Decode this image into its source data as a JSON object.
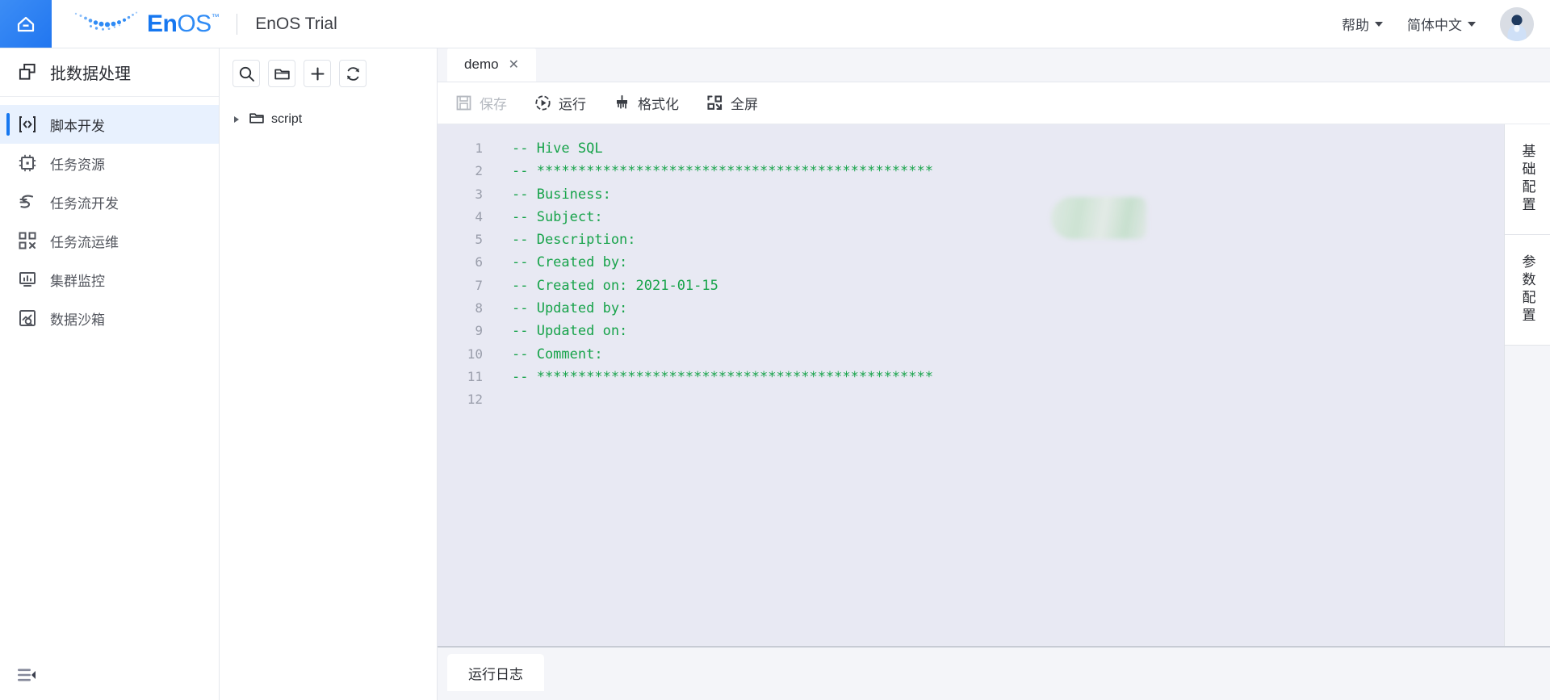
{
  "header": {
    "home_icon": "home-icon",
    "logo_en": "En",
    "logo_os": "OS",
    "logo_tm": "™",
    "product_title": "EnOS Trial",
    "help_label": "帮助",
    "language_label": "简体中文",
    "avatar": "user-avatar"
  },
  "sidebar": {
    "section_title": "批数据处理",
    "section_icon": "batch-data-icon",
    "items": [
      {
        "label": "脚本开发",
        "icon": "script-dev-icon",
        "active": true
      },
      {
        "label": "任务资源",
        "icon": "task-resource-icon",
        "active": false
      },
      {
        "label": "任务流开发",
        "icon": "workflow-dev-icon",
        "active": false
      },
      {
        "label": "任务流运维",
        "icon": "workflow-ops-icon",
        "active": false
      },
      {
        "label": "集群监控",
        "icon": "cluster-monitor-icon",
        "active": false
      },
      {
        "label": "数据沙箱",
        "icon": "data-sandbox-icon",
        "active": false
      }
    ],
    "collapse_icon": "collapse-sidebar-icon"
  },
  "tree": {
    "toolbar": [
      {
        "icon": "search-icon",
        "name": "search-button"
      },
      {
        "icon": "folder-icon",
        "name": "new-folder-button"
      },
      {
        "icon": "plus-icon",
        "name": "new-file-button"
      },
      {
        "icon": "refresh-icon",
        "name": "refresh-button"
      }
    ],
    "nodes": [
      {
        "label": "script",
        "icon": "folder-icon",
        "expanded": false
      }
    ]
  },
  "editor": {
    "tabs": [
      {
        "label": "demo",
        "close": "✕",
        "active": true
      }
    ],
    "toolbar": [
      {
        "label": "保存",
        "icon": "save-icon",
        "disabled": true
      },
      {
        "label": "运行",
        "icon": "run-icon",
        "disabled": false
      },
      {
        "label": "格式化",
        "icon": "format-icon",
        "disabled": false
      },
      {
        "label": "全屏",
        "icon": "fullscreen-icon",
        "disabled": false
      }
    ],
    "code_lines": [
      {
        "n": "1",
        "text": "-- Hive SQL"
      },
      {
        "n": "2",
        "text": "-- ************************************************"
      },
      {
        "n": "3",
        "text": "-- Business:"
      },
      {
        "n": "4",
        "text": "-- Subject:"
      },
      {
        "n": "5",
        "text": "-- Description:"
      },
      {
        "n": "6",
        "text": "-- Created by:"
      },
      {
        "n": "7",
        "text": "-- Created on: 2021-01-15"
      },
      {
        "n": "8",
        "text": "-- Updated by:"
      },
      {
        "n": "9",
        "text": "-- Updated on:"
      },
      {
        "n": "10",
        "text": "-- Comment:"
      },
      {
        "n": "11",
        "text": "-- ************************************************"
      },
      {
        "n": "12",
        "text": ""
      }
    ],
    "comment_color": "#17a34a",
    "background_color": "#e8e9f3"
  },
  "right_tabs": [
    {
      "label": "基础配置",
      "name": "tab-basic-config"
    },
    {
      "label": "参数配置",
      "name": "tab-parameter-config"
    }
  ],
  "log_panel": {
    "tabs": [
      {
        "label": "运行日志",
        "active": true
      }
    ]
  }
}
